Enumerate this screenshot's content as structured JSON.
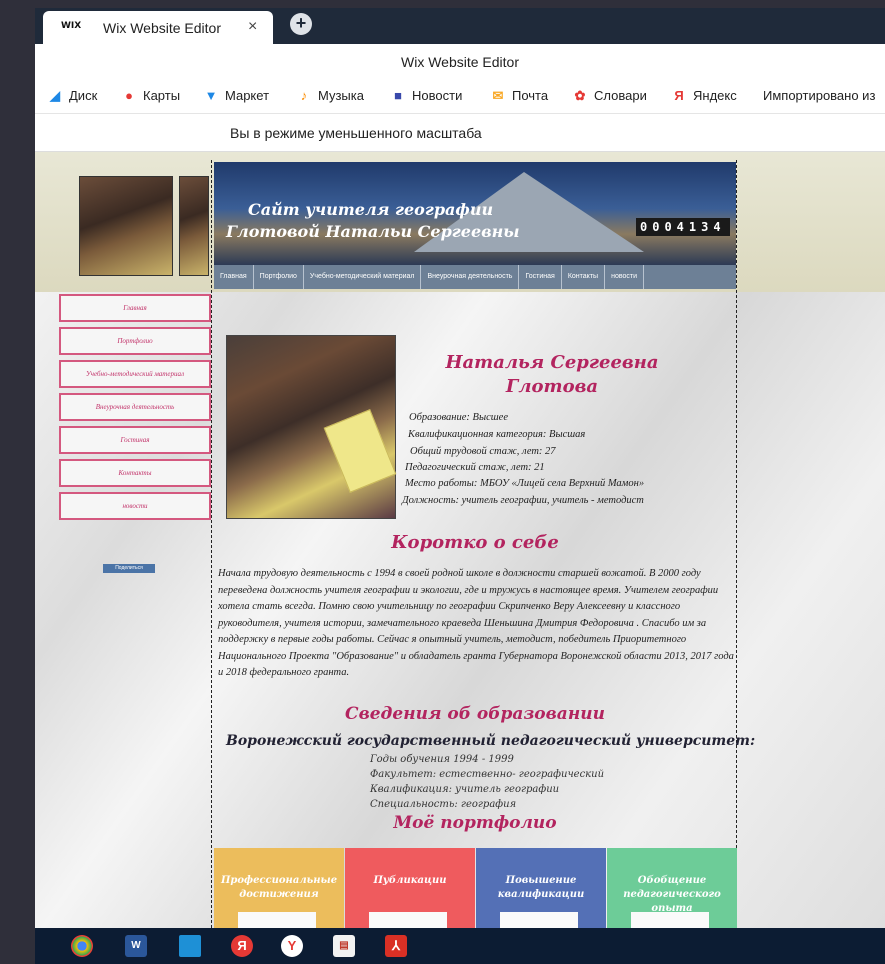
{
  "browser": {
    "tab_title": "Wix Website Editor",
    "tab_favicon": "WIX",
    "tab_close": "×",
    "new_tab": "+",
    "window_title": "Wix Website Editor",
    "bookmarks": [
      {
        "icon": "disk-icon",
        "label": "Диск"
      },
      {
        "icon": "maps-pin-icon",
        "label": "Карты"
      },
      {
        "icon": "cart-icon",
        "label": "Маркет"
      },
      {
        "icon": "music-icon",
        "label": "Музыка"
      },
      {
        "icon": "news-icon",
        "label": "Новости"
      },
      {
        "icon": "mail-icon",
        "label": "Почта"
      },
      {
        "icon": "dictionary-icon",
        "label": "Словари"
      },
      {
        "icon": "yandex-icon",
        "label": "Яндекс"
      },
      {
        "icon": "",
        "label": "Импортировано из"
      }
    ],
    "zoom_notice": "Вы в режиме уменьшенного масштаба"
  },
  "site": {
    "banner_line1": "Сайт учителя географии",
    "banner_line2": "Глотовой Натальи Сергеевны",
    "counter": "0004134",
    "nav": [
      "Главная",
      "Портфолио",
      "Учебно-методический материал",
      "Внеурочная деятельность",
      "Гостиная",
      "Контакты",
      "новости"
    ],
    "left_menu": [
      "Главная",
      "Портфолио",
      "Учебно-методический материал",
      "Внеурочная деятельность",
      "Гостиная",
      "Контакты",
      "новости"
    ],
    "vk_button": "Поделиться",
    "name_line1": "Наталья Сергеевна",
    "name_line2": "Глотова",
    "info": [
      "Образование: Высшее",
      "Квалификационная категория: Высшая",
      "Общий трудовой стаж, лет: 27",
      "Педагогический стаж, лет: 21",
      "Место работы: МБОУ «Лицей села Верхний Мамон»",
      "Должность: учитель географии, учитель - методист"
    ],
    "about_heading": "Коротко о себе",
    "about_text": "Начала трудовую деятельность с 1994 в своей родной школе в должности старшей вожатой. В 2000 году переведена должность учителя географии и экологии, где и тружусь в настоящее время. Учителем географии хотела стать всегда. Помню свою учительницу по географии Скрипченко Веру Алексеевну и классного руководителя, учителя истории, замечательного краеведа Шеньшина Дмитрия Федоровича . Спасибо им за поддержку в первые годы работы. Сейчас я опытный учитель, методист, победитель Приоритетного Национального Проекта \"Образование\" и обладатель гранта Губернатора Воронежской области 2013, 2017 года и 2018 федерального гранта.",
    "education_heading": "Сведения об образовании",
    "university": "Воронежский государственный педагогический университет:",
    "education": [
      "Годы обучения 1994 - 1999",
      "Факультет: естественно- географический",
      "Квалификация: учитель географии",
      "Специальность: география"
    ],
    "portfolio_heading": "Моё портфолио",
    "cards": [
      {
        "title": "Профессиональные достижения",
        "color": "#ecbd5c"
      },
      {
        "title": "Публикации",
        "color": "#ef5b5e"
      },
      {
        "title": "Повышение квалификации",
        "color": "#5470b6"
      },
      {
        "title": "Обобщение педагогического опыта",
        "color": "#6dcc98"
      }
    ]
  },
  "taskbar": [
    {
      "icon": "chrome-icon"
    },
    {
      "icon": "word-icon"
    },
    {
      "icon": "file-explorer-icon"
    },
    {
      "icon": "yandex-icon"
    },
    {
      "icon": "yandex-browser-icon"
    },
    {
      "icon": "document-icon"
    },
    {
      "icon": "acrobat-icon"
    }
  ]
}
